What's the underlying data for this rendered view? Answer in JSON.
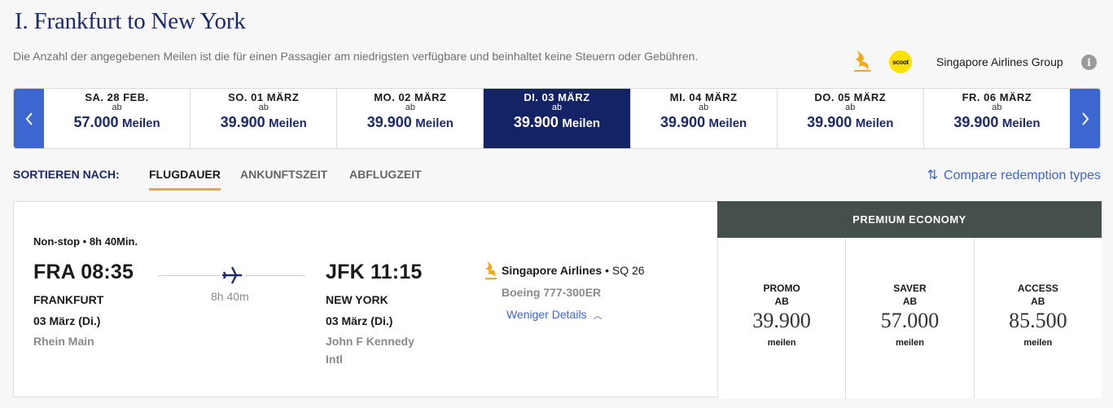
{
  "header": {
    "title": "I. Frankfurt to New York",
    "disclaimer": "Die Anzahl der angegebenen Meilen ist die für einen Passagier am niedrigsten verfügbare und beinhaltet keine Steuern oder Gebühren.",
    "scoot_label": "scoot",
    "group_name": "Singapore Airlines Group",
    "info_icon_label": "i"
  },
  "date_strip": {
    "prev_icon": "chevron-left-icon",
    "next_icon": "chevron-right-icon",
    "dates": [
      {
        "label": "SA. 28 FEB.",
        "ab": "ab",
        "price": "57.000",
        "unit": "Meilen",
        "selected": false
      },
      {
        "label": "SO. 01 MÄRZ",
        "ab": "ab",
        "price": "39.900",
        "unit": "Meilen",
        "selected": false
      },
      {
        "label": "MO. 02 MÄRZ",
        "ab": "ab",
        "price": "39.900",
        "unit": "Meilen",
        "selected": false
      },
      {
        "label": "DI. 03 MÄRZ",
        "ab": "ab",
        "price": "39.900",
        "unit": "Meilen",
        "selected": true
      },
      {
        "label": "MI. 04 MÄRZ",
        "ab": "ab",
        "price": "39.900",
        "unit": "Meilen",
        "selected": false
      },
      {
        "label": "DO. 05 MÄRZ",
        "ab": "ab",
        "price": "39.900",
        "unit": "Meilen",
        "selected": false
      },
      {
        "label": "FR. 06 MÄRZ",
        "ab": "ab",
        "price": "39.900",
        "unit": "Meilen",
        "selected": false
      }
    ]
  },
  "sort": {
    "label": "SORTIEREN NACH:",
    "options": [
      "FLUGDAUER",
      "ANKUNFTSZEIT",
      "ABFLUGZEIT"
    ],
    "active": "FLUGDAUER",
    "compare_label": "Compare redemption types",
    "compare_icon": "sort-arrows-icon"
  },
  "flight": {
    "summary": "Non-stop • 8h 40Min.",
    "departure": {
      "code_time": "FRA 08:35",
      "city": "FRANKFURT",
      "date": "03 März (Di.)",
      "airport": "Rhein Main"
    },
    "arrival": {
      "code_time": "JFK 11:15",
      "city": "NEW YORK",
      "date": "03 März (Di.)",
      "airport_line1": "John F Kennedy",
      "airport_line2": "Intl"
    },
    "duration": "8h 40m",
    "airline": "Singapore Airlines",
    "flight_number": " • SQ 26",
    "aircraft": "Boeing 777-300ER",
    "less_details": "Weniger Details",
    "less_details_icon": "chevron-up-icon"
  },
  "fares": {
    "cabin": "PREMIUM ECONOMY",
    "options": [
      {
        "name": "PROMO",
        "ab": "AB",
        "price": "39.900",
        "unit": "meilen"
      },
      {
        "name": "SAVER",
        "ab": "AB",
        "price": "57.000",
        "unit": "meilen"
      },
      {
        "name": "ACCESS",
        "ab": "AB",
        "price": "85.500",
        "unit": "meilen"
      }
    ]
  },
  "colors": {
    "brand_navy": "#142366",
    "accent_blue": "#3c67d0",
    "sort_underline": "#e9a53c",
    "cabin_header": "#454f4c",
    "scoot_yellow": "#ffe100"
  }
}
